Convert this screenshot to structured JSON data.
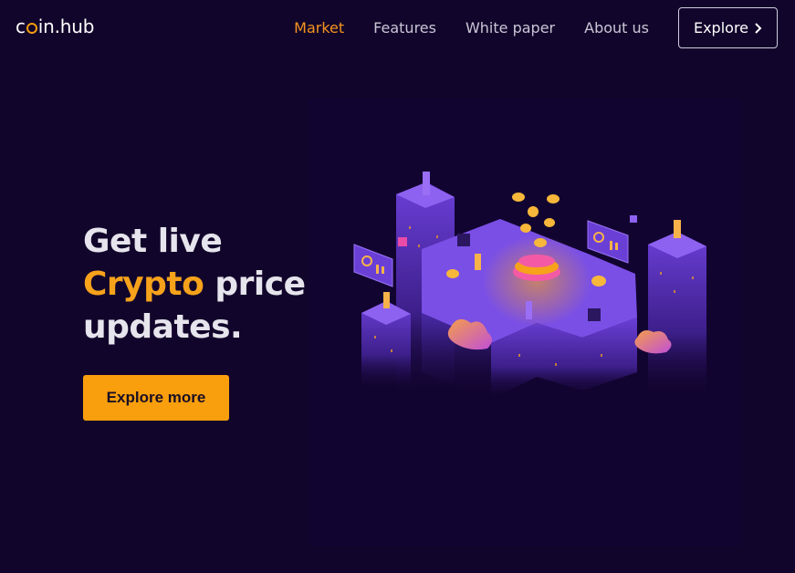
{
  "brand": {
    "prefix": "c",
    "suffix": "in.hub"
  },
  "nav": {
    "links": [
      "Market",
      "Features",
      "White paper",
      "About us"
    ],
    "active": "Market",
    "explore_label": "Explore"
  },
  "hero": {
    "line1": "Get live",
    "line2_accent": "Crypto",
    "line2_rest": " price",
    "line3": "updates."
  },
  "cta": {
    "label": "Explore more"
  },
  "colors": {
    "background": "#12052b",
    "accent": "#f7a21b",
    "cta_bg": "#f99f0d",
    "purple": "#6a3fd6"
  },
  "icons": {
    "explore": "chevron-right-icon",
    "logo_o": "coin-ring-icon"
  },
  "illustration": "isometric-crypto-city"
}
